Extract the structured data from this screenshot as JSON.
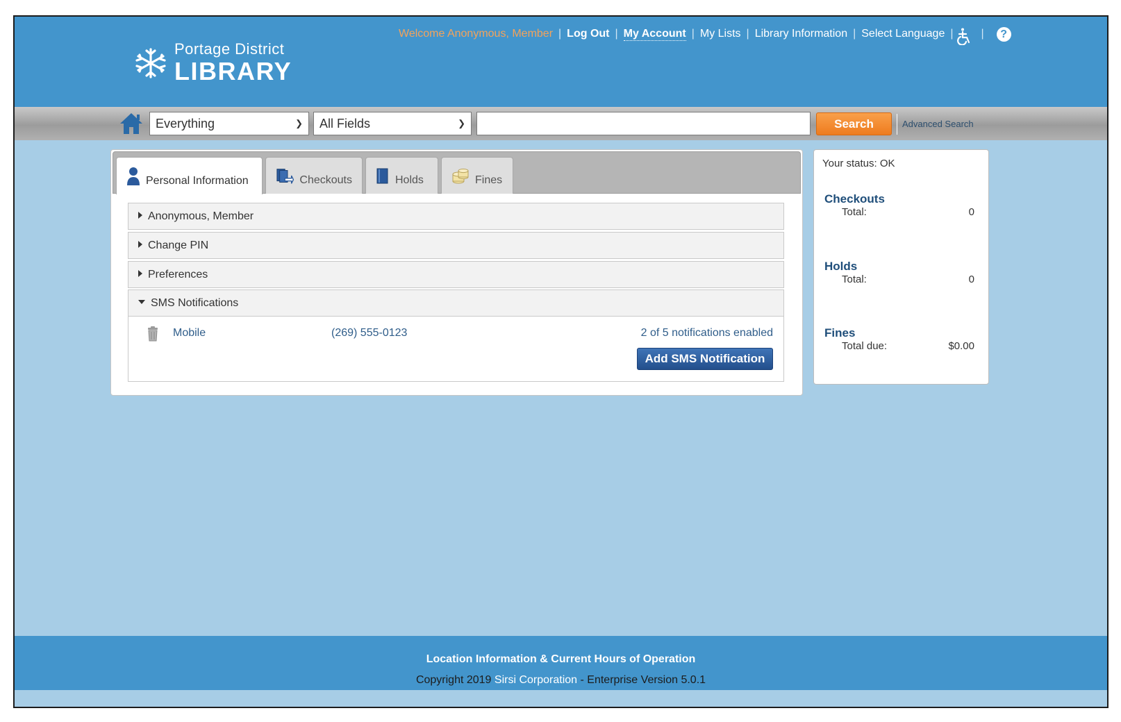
{
  "header": {
    "logo_line1": "Portage District",
    "logo_line2": "LIBRARY",
    "welcome": "Welcome Anonymous, Member",
    "links": {
      "logout": "Log Out",
      "my_account": "My Account",
      "my_lists": "My Lists",
      "library_info": "Library Information",
      "select_language": "Select Language"
    },
    "separator": "|",
    "help_glyph": "?"
  },
  "search": {
    "type_selected": "Everything",
    "field_selected": "All Fields",
    "query_value": "",
    "query_placeholder": "",
    "button_label": "Search",
    "advanced_label": "Advanced Search"
  },
  "tabs": [
    {
      "label": "Personal Information",
      "icon": "person-icon",
      "active": true
    },
    {
      "label": "Checkouts",
      "icon": "checkouts-icon",
      "active": false
    },
    {
      "label": "Holds",
      "icon": "holds-book-icon",
      "active": false
    },
    {
      "label": "Fines",
      "icon": "fines-coins-icon",
      "active": false
    }
  ],
  "sections": [
    {
      "label": "Anonymous, Member",
      "expanded": false
    },
    {
      "label": "Change PIN",
      "expanded": false
    },
    {
      "label": "Preferences",
      "expanded": false
    },
    {
      "label": "SMS Notifications",
      "expanded": true
    }
  ],
  "sms": {
    "device_label": "Mobile",
    "phone": "(269) 555-0123",
    "enabled_text": "2 of 5 notifications enabled",
    "add_button": "Add SMS Notification"
  },
  "status": {
    "status_text": "Your status: OK",
    "checkouts": {
      "title": "Checkouts",
      "label": "Total:",
      "value": "0"
    },
    "holds": {
      "title": "Holds",
      "label": "Total:",
      "value": "0"
    },
    "fines": {
      "title": "Fines",
      "label": "Total due:",
      "value": "$0.00"
    }
  },
  "footer": {
    "hours_link": "Location Information & Current Hours of Operation",
    "copyright_prefix": "Copyright 2019 ",
    "company": "Sirsi Corporation",
    "version": " - Enterprise Version 5.0.1"
  },
  "colors": {
    "header_blue": "#4395cc",
    "background_blue": "#a7cde6",
    "search_orange": "#f28a2d",
    "button_navy": "#2b5a9c",
    "welcome_orange": "#f3a35b"
  }
}
